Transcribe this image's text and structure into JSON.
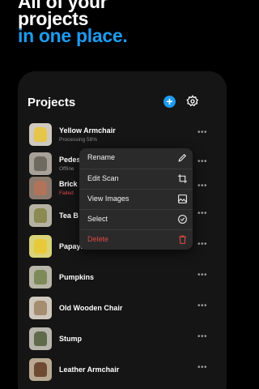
{
  "hero": {
    "line1": "All of your",
    "line2": "projects",
    "line3": "in one place."
  },
  "header": {
    "title": "Projects",
    "add_label": "+"
  },
  "projects": [
    {
      "name": "Yellow Armchair",
      "status": "Processing 58%",
      "status_color": "gray",
      "more": "•••"
    },
    {
      "name": "Pedes",
      "status": "Offline",
      "status_color": "gray",
      "more": "•••"
    },
    {
      "name": "Brick",
      "status": "Failed",
      "status_color": "red",
      "more": "•••"
    },
    {
      "name": "Tea B",
      "status": "",
      "more": "•••"
    },
    {
      "name": "Papaya",
      "status": "",
      "more": "•••"
    },
    {
      "name": "Pumpkins",
      "status": "",
      "more": "•••"
    },
    {
      "name": "Old Wooden Chair",
      "status": "",
      "more": "•••"
    },
    {
      "name": "Stump",
      "status": "",
      "more": "•••"
    },
    {
      "name": "Leather Armchair",
      "status": "",
      "more": "•••"
    }
  ],
  "context_menu": {
    "items": [
      {
        "label": "Rename",
        "icon": "pencil-icon"
      },
      {
        "label": "Edit Scan",
        "icon": "crop-icon"
      },
      {
        "label": "View Images",
        "icon": "image-icon"
      },
      {
        "label": "Select",
        "icon": "check-circle-icon"
      },
      {
        "label": "Delete",
        "icon": "trash-icon",
        "danger": true
      }
    ]
  },
  "colors": {
    "accent": "#1e9bf0",
    "danger": "#e04848",
    "panel": "#151515",
    "menu": "#2a2a2a"
  }
}
